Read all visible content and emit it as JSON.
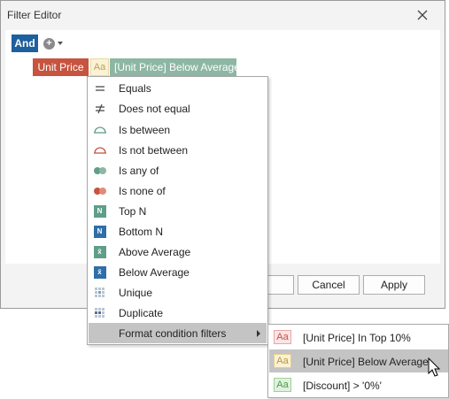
{
  "window": {
    "title": "Filter Editor",
    "close_icon": "close-icon"
  },
  "editor": {
    "group_operator": "And",
    "add_icon": "plus-circle-icon",
    "field": "Unit Price",
    "condition_icon_text": "Aa",
    "condition": "[Unit Price] Below Average"
  },
  "dialog_buttons": {
    "ok": "",
    "cancel": "Cancel",
    "apply": "Apply"
  },
  "menu": {
    "items": [
      {
        "label": "Equals",
        "icon": "equals-icon"
      },
      {
        "label": "Does not equal",
        "icon": "not-equal-icon"
      },
      {
        "label": "Is between",
        "icon": "between-icon"
      },
      {
        "label": "Is not between",
        "icon": "not-between-icon"
      },
      {
        "label": "Is any of",
        "icon": "any-of-icon"
      },
      {
        "label": "Is none of",
        "icon": "none-of-icon"
      },
      {
        "label": "Top N",
        "icon": "top-n-icon",
        "badge": "N"
      },
      {
        "label": "Bottom N",
        "icon": "bottom-n-icon",
        "badge": "N"
      },
      {
        "label": "Above Average",
        "icon": "above-average-icon",
        "badge": "x̄"
      },
      {
        "label": "Below Average",
        "icon": "below-average-icon",
        "badge": "x̄"
      },
      {
        "label": "Unique",
        "icon": "unique-icon"
      },
      {
        "label": "Duplicate",
        "icon": "duplicate-icon"
      },
      {
        "label": "Format condition filters",
        "icon": "",
        "highlighted": true
      }
    ]
  },
  "submenu": {
    "items": [
      {
        "icon_text": "Aa",
        "label": "[Unit Price] In Top 10%",
        "bg": "#fde4e4",
        "border": "#e9a6a6",
        "fg": "#c0504d"
      },
      {
        "icon_text": "Aa",
        "label": "[Unit Price] Below Average",
        "bg": "#fbf2d6",
        "border": "#e2cf91",
        "fg": "#b8963e",
        "highlighted": true
      },
      {
        "icon_text": "Aa",
        "label": "[Discount] > '0%'",
        "bg": "#dff2de",
        "border": "#9fcf9b",
        "fg": "#4e9a4a"
      }
    ]
  },
  "colors": {
    "and_blue": "#1e5f9d",
    "field_red": "#c6543f",
    "condition_green": "#8db6a4",
    "highlight_gray": "#c4c4c4"
  }
}
